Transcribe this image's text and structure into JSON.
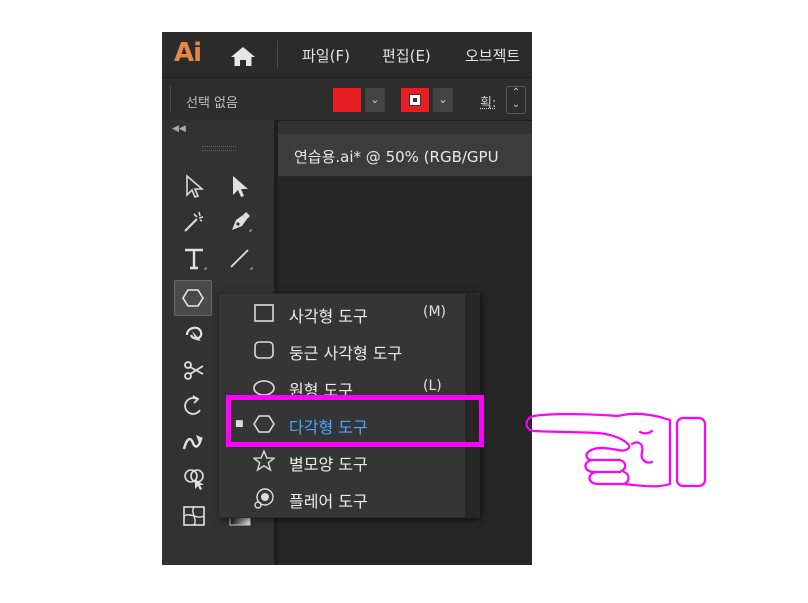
{
  "app": {
    "logo": "Ai",
    "menu": [
      "파일(F)",
      "편집(E)",
      "오브젝트"
    ],
    "control_bar": {
      "selection_label": "선택 없음",
      "fill_color": "#ea1c24",
      "stroke_color": "#ea1c24",
      "stroke_label": "획:"
    }
  },
  "document_tab": "연습용.ai* @ 50% (RGB/GPU",
  "toolbar": {
    "tools": [
      "selection",
      "direct-selection",
      "magic-wand",
      "pen",
      "type",
      "line",
      "polygon",
      "shaper",
      "scissors",
      "rotate",
      "warp",
      "shape-builder",
      "mesh",
      "gradient"
    ]
  },
  "flyout": {
    "items": [
      {
        "label": "사각형 도구",
        "shortcut": "(M)",
        "icon": "rectangle-icon",
        "active": false
      },
      {
        "label": "둥근 사각형 도구",
        "shortcut": "",
        "icon": "rounded-rectangle-icon",
        "active": false
      },
      {
        "label": "원형 도구",
        "shortcut": "(L)",
        "icon": "ellipse-icon",
        "active": false
      },
      {
        "label": "다각형 도구",
        "shortcut": "",
        "icon": "polygon-icon",
        "active": true
      },
      {
        "label": "별모양 도구",
        "shortcut": "",
        "icon": "star-icon",
        "active": false
      },
      {
        "label": "플레어 도구",
        "shortcut": "",
        "icon": "flare-icon",
        "active": false
      }
    ]
  },
  "annotation": {
    "highlight_color": "#ff00ff"
  },
  "colors": {
    "active_item_text": "#4aa8ff",
    "highlight": "#ff00ff"
  }
}
